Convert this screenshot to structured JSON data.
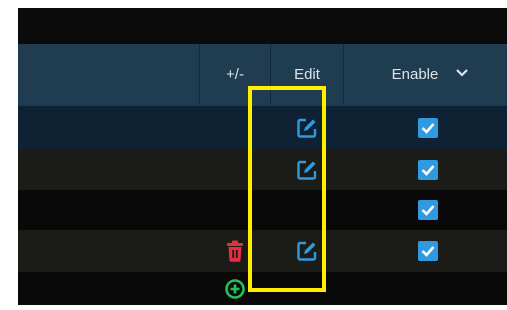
{
  "header": {
    "plus_minus_label": "+/-",
    "edit_label": "Edit",
    "enable_label": "Enable",
    "enable_dropdown_icon": "chevron-down-icon"
  },
  "rows": [
    {
      "edit_icon": "edit-icon",
      "enabled": true
    },
    {
      "edit_icon": "edit-icon",
      "enabled": true
    },
    {
      "edit_icon": null,
      "enabled": true
    },
    {
      "delete_icon": "trash-icon",
      "edit_icon": "edit-icon",
      "enabled": true
    },
    {
      "add_icon": "plus-circle-icon"
    }
  ],
  "colors": {
    "header_bg": "#1f3c50",
    "checkbox": "#2f9ae0",
    "edit_icon": "#2f9ae0",
    "delete_icon": "#e53040",
    "add_icon": "#22c25a",
    "highlight": "#ffee00"
  }
}
